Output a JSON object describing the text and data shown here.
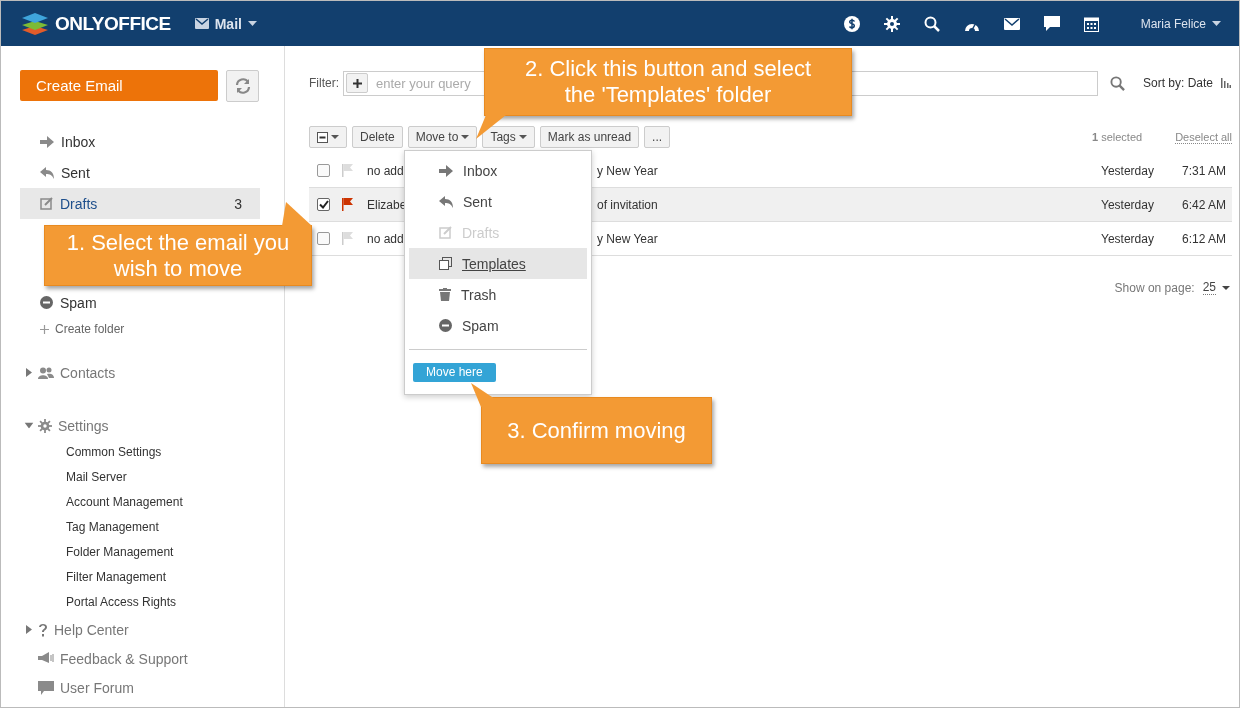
{
  "header": {
    "logo": "ONLYOFFICE",
    "module": "Mail",
    "user": "Maria Felice"
  },
  "sidebar": {
    "create": "Create Email",
    "folders": [
      {
        "label": "Inbox",
        "selected": false
      },
      {
        "label": "Sent",
        "selected": false
      },
      {
        "label": "Drafts",
        "count": "3",
        "selected": true
      },
      {
        "label": "Spam",
        "selected": false
      }
    ],
    "create_folder": "Create folder",
    "contacts": {
      "label": "Contacts",
      "expanded": false
    },
    "settings": {
      "label": "Settings",
      "expanded": true,
      "children": [
        "Common Settings",
        "Mail Server",
        "Account Management",
        "Tag Management",
        "Folder Management",
        "Filter Management",
        "Portal Access Rights"
      ]
    },
    "help": {
      "label": "Help Center",
      "expanded": false
    },
    "links": [
      "Feedback & Support",
      "User Forum"
    ]
  },
  "filter": {
    "label": "Filter:",
    "placeholder": "enter your query",
    "sort": "Sort by: Date"
  },
  "toolbar": {
    "buttons": [
      {
        "label": "Delete",
        "caret": false
      },
      {
        "label": "Move to",
        "caret": true
      },
      {
        "label": "Tags",
        "caret": true
      },
      {
        "label": "Mark as unread",
        "caret": false
      },
      {
        "label": "...",
        "caret": false
      }
    ],
    "selection": "**1** selected",
    "deselect": "Deselect all"
  },
  "rows": [
    {
      "sender": "no add",
      "subject": "y New Year",
      "day": "Yesterday",
      "time": "7:31 AM",
      "checked": false,
      "flagged": false
    },
    {
      "sender": "Elizabe",
      "subject": "of invitation",
      "day": "Yesterday",
      "time": "6:42 AM",
      "checked": true,
      "flagged": true
    },
    {
      "sender": "no add",
      "subject": "y New Year",
      "day": "Yesterday",
      "time": "6:12 AM",
      "checked": false,
      "flagged": false
    }
  ],
  "pager": {
    "label": "Show on page:",
    "value": "25"
  },
  "menu": {
    "items": [
      {
        "label": "Inbox",
        "disabled": false,
        "selected": false
      },
      {
        "label": "Sent",
        "disabled": false,
        "selected": false
      },
      {
        "label": "Drafts",
        "disabled": true,
        "selected": false
      },
      {
        "label": "Templates",
        "disabled": false,
        "selected": true
      },
      {
        "label": "Trash",
        "disabled": false,
        "selected": false
      },
      {
        "label": "Spam",
        "disabled": false,
        "selected": false
      }
    ],
    "button": "Move here"
  },
  "callouts": [
    "1. Select the email you wish to move",
    "2. Click this button and select the 'Templates' folder",
    "3. Confirm moving"
  ]
}
